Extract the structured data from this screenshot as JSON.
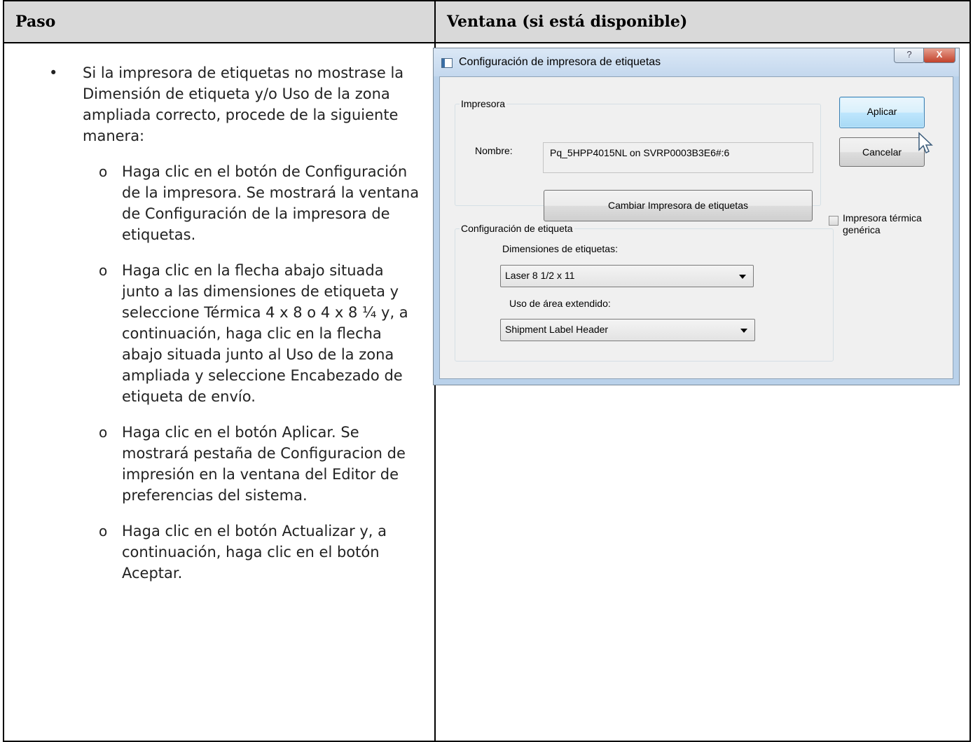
{
  "table": {
    "col1_header": "Paso",
    "col2_header": "Ventana (si está disponible)"
  },
  "step": {
    "bullet_mark": "•",
    "sub_mark": "o",
    "intro": "Si la impresora de etiquetas no mostrase la Dimensión de etiqueta y/o Uso de la zona ampliada correcto, procede de la siguiente manera:",
    "substeps": [
      "Haga clic en el botón de Configuración de la impresora. Se mostrará la ventana de Configuración de la impresora de etiquetas.",
      "Haga clic en la flecha abajo situada junto a las dimensiones de etiqueta y seleccione Térmica 4 x 8 o 4 x 8 ¼ y, a continuación, haga clic en la flecha abajo situada junto al Uso de la zona ampliada y seleccione Encabezado de etiqueta de envío.",
      "Haga clic en el botón Aplicar. Se mostrará pestaña de Configuracion de impresión en la ventana del Editor de preferencias del sistema.",
      "Haga clic en el botón Actualizar y, a continuación, haga clic en el botón Aceptar."
    ]
  },
  "dialog": {
    "title": "Configuración de impresora de etiquetas",
    "help_glyph": "?",
    "close_glyph": "X",
    "printer_group": "Impresora",
    "name_label": "Nombre:",
    "name_value": "Pq_5HPP4015NL on SVRP0003B3E6#:6",
    "change_button": "Cambiar Impresora de etiquetas",
    "apply_button": "Aplicar",
    "cancel_button": "Cancelar",
    "thermal_checkbox_line1": "Impresora térmica",
    "thermal_checkbox_line2": "genérica",
    "thermal_checked": false,
    "label_group": "Configuración de etiqueta",
    "dimensions_label": "Dimensiones de etiquetas:",
    "dimensions_value": "Laser 8 1/2 x 11",
    "extended_label": "Uso de área extendido:",
    "extended_value": "Shipment Label Header"
  }
}
